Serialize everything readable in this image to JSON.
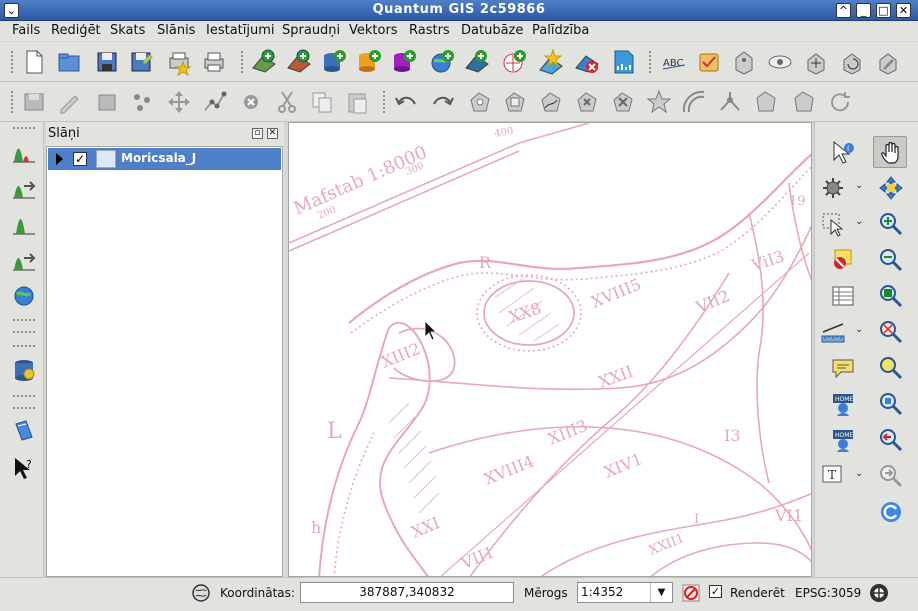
{
  "window": {
    "title": "Quantum GIS 2c59866"
  },
  "menubar": {
    "items": [
      {
        "label": "Fails",
        "key": "F"
      },
      {
        "label": "Rediģēt",
        "key": "R"
      },
      {
        "label": "Skats",
        "key": "S"
      },
      {
        "label": "Slānis",
        "key": "l"
      },
      {
        "label": "Iestatījumi",
        "key": "I"
      },
      {
        "label": "Spraudņi",
        "key": "p"
      },
      {
        "label": "Vektors",
        "key": "V"
      },
      {
        "label": "Rastrs",
        "key": "R"
      },
      {
        "label": "Datubāze",
        "key": "D"
      },
      {
        "label": "Palīdzība",
        "key": "P"
      }
    ]
  },
  "layers_panel": {
    "title": "Slāņi",
    "layers": [
      {
        "name": "Moricsala_J",
        "checked": true,
        "selected": true
      }
    ]
  },
  "map": {
    "scale_title": "Mafstab 1:8000",
    "labels": [
      "400",
      "300",
      "200",
      "XVIII5",
      "VII2",
      "XX8",
      "XIII2",
      "XXI",
      "L",
      "XVIII4",
      "XIII3",
      "XIV1",
      "VII1",
      "XXII",
      "XXII1",
      "ViI3",
      "I3",
      "VI1",
      "h",
      "R",
      "19",
      "I"
    ]
  },
  "statusbar": {
    "coord_label": "Koordinātas:",
    "coordinates": "387887,340832",
    "scale_label": "Mērogs",
    "scale_value": "1:4352",
    "render_label": "Renderēt",
    "render_checked": true,
    "crs": "EPSG:3059"
  },
  "colors": {
    "accent": "#4f7fc7",
    "map_ink": "#e8a9b6"
  }
}
